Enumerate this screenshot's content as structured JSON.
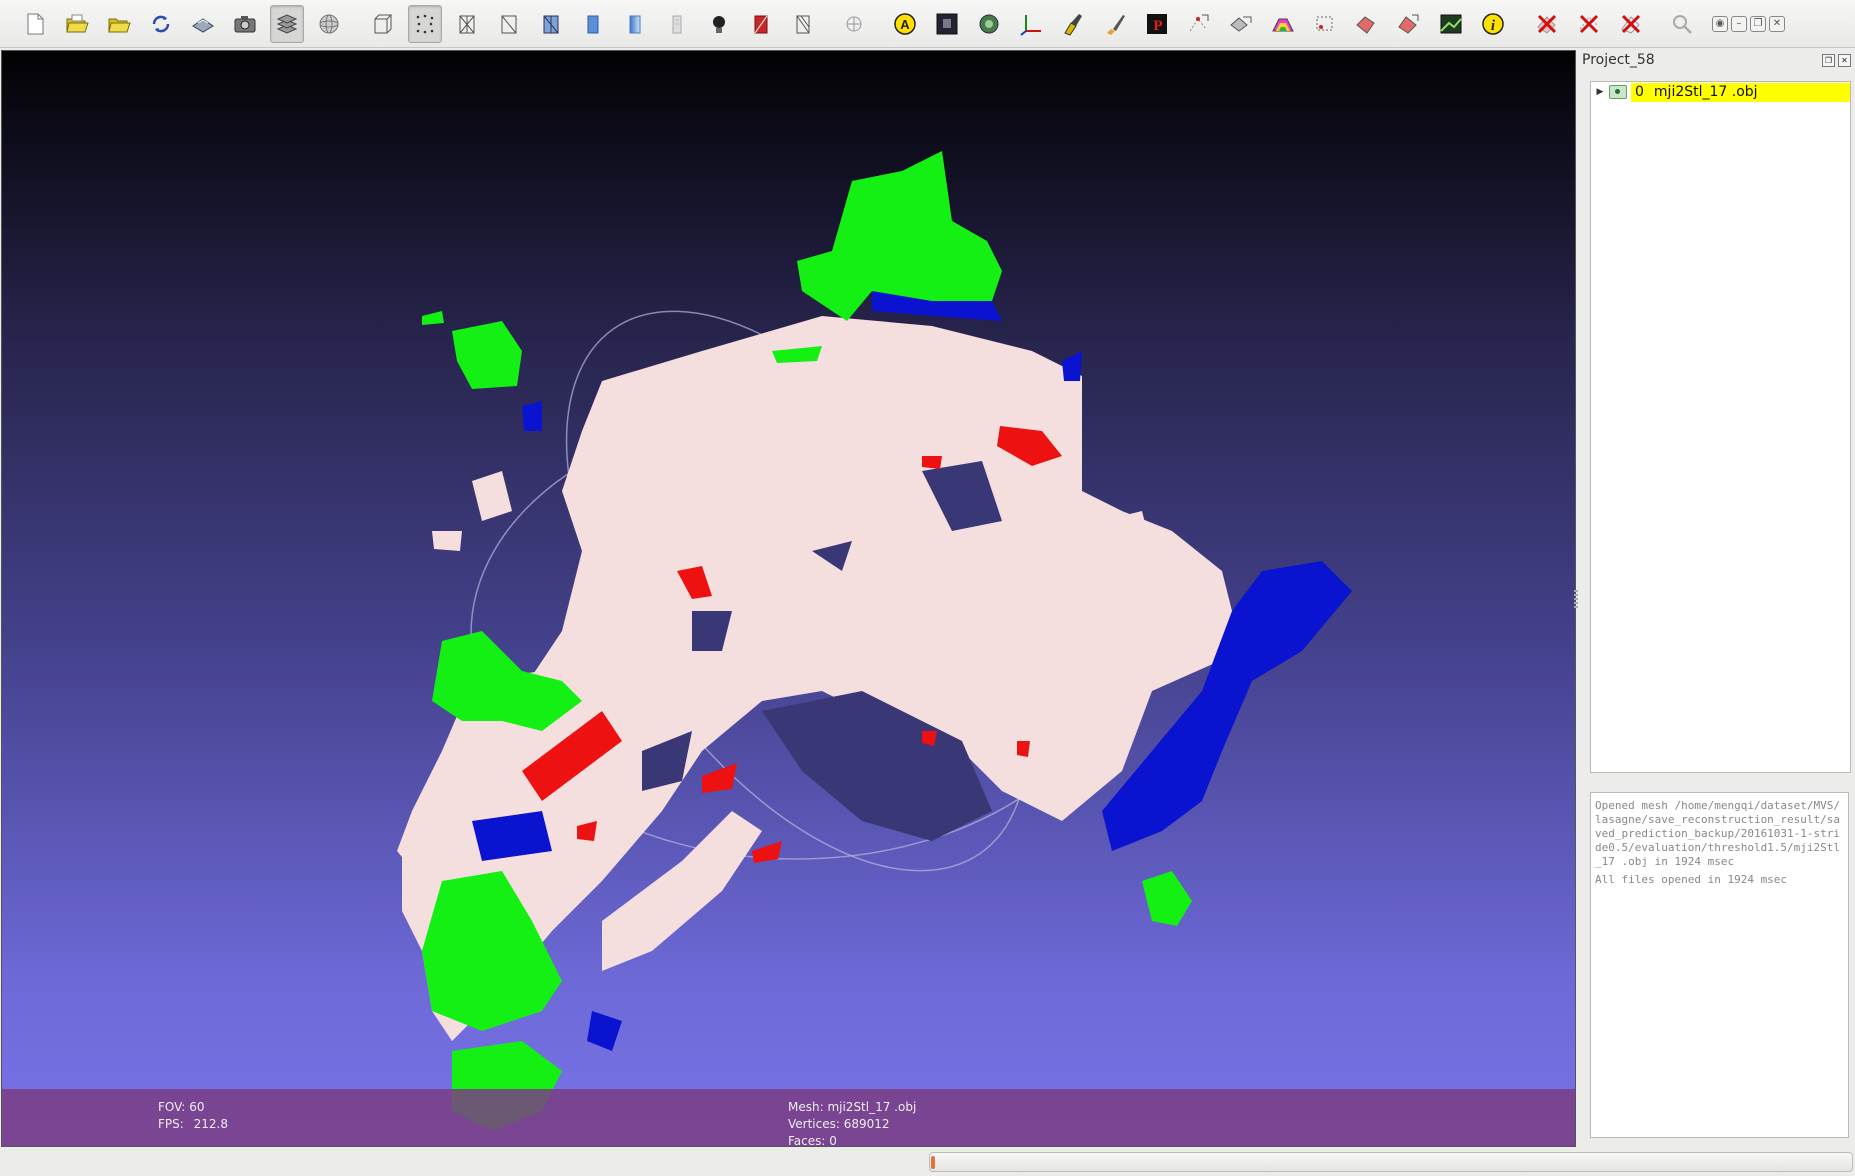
{
  "toolbar": {
    "buttons": [
      {
        "name": "new-project",
        "icon": "new-file-icon"
      },
      {
        "name": "open-project",
        "icon": "open-folder-icon"
      },
      {
        "name": "import-mesh",
        "icon": "folder-icon"
      },
      {
        "name": "reload",
        "icon": "reload-icon"
      },
      {
        "name": "export",
        "icon": "save-icon"
      },
      {
        "name": "snapshot",
        "icon": "camera-icon"
      },
      {
        "name": "layers",
        "icon": "layers-icon",
        "pressed": true
      },
      {
        "name": "trackball",
        "icon": "trackball-icon"
      },
      {
        "name": "bbox",
        "icon": "bbox-icon"
      },
      {
        "name": "points",
        "icon": "points-icon",
        "pressed": true
      },
      {
        "name": "wireframe",
        "icon": "wireframe-icon"
      },
      {
        "name": "hidden-lines",
        "icon": "hidden-lines-icon"
      },
      {
        "name": "flat-lines",
        "icon": "flat-lines-icon"
      },
      {
        "name": "flat",
        "icon": "flat-icon"
      },
      {
        "name": "smooth",
        "icon": "smooth-icon"
      },
      {
        "name": "texture",
        "icon": "texture-icon"
      },
      {
        "name": "light",
        "icon": "light-bulb-icon"
      },
      {
        "name": "backface",
        "icon": "backface-icon"
      },
      {
        "name": "double-side",
        "icon": "double-side-icon"
      },
      {
        "name": "globe",
        "icon": "globe-icon"
      },
      {
        "name": "annotation",
        "icon": "annotation-icon"
      },
      {
        "name": "raster",
        "icon": "raster-icon"
      },
      {
        "name": "select-region",
        "icon": "select-region-icon"
      },
      {
        "name": "axis",
        "icon": "axis-icon"
      },
      {
        "name": "paint",
        "icon": "paint-icon"
      },
      {
        "name": "brush",
        "icon": "brush-icon"
      },
      {
        "name": "measure",
        "icon": "measure-icon"
      },
      {
        "name": "select-vertices",
        "icon": "select-vertices-icon"
      },
      {
        "name": "select-faces",
        "icon": "select-faces-icon"
      },
      {
        "name": "color-faces",
        "icon": "color-faces-icon"
      },
      {
        "name": "select-connected",
        "icon": "select-connected-icon"
      },
      {
        "name": "delete-region",
        "icon": "delete-region-icon"
      },
      {
        "name": "delete-vertices",
        "icon": "delete-vertices-icon"
      },
      {
        "name": "image-align",
        "icon": "image-align-icon"
      },
      {
        "name": "info",
        "icon": "info-icon"
      },
      {
        "name": "delete-selected-faces",
        "icon": "delete-faces-icon"
      },
      {
        "name": "delete-selected-vertices",
        "icon": "delete-vertices-x-icon"
      },
      {
        "name": "delete-selected-all",
        "icon": "delete-all-icon"
      },
      {
        "name": "search",
        "icon": "search-icon"
      }
    ]
  },
  "viewport": {
    "fov_label": "FOV: 60",
    "fps_label": "FPS:",
    "fps_value": "212.8",
    "mesh_label": "Mesh: mji2Stl_17 .obj",
    "vertices_label": "Vertices: 689012",
    "faces_label": "Faces: 0"
  },
  "panel": {
    "title": "Project_58",
    "layers": [
      {
        "id": "0",
        "name": "mji2Stl_17 .obj",
        "selected": true
      }
    ],
    "log": [
      "Opened mesh /home/mengqi/dataset/MVS/lasagne/save_reconstruction_result/saved_prediction_backup/20161031-1-stride0.5/evaluation/threshold1.5/mji2Stl_17 .obj in 1924 msec",
      "All files opened in 1924 msec"
    ]
  },
  "status": {
    "progress_fraction": 0.004
  },
  "colors": {
    "accent_selected": "#ffff00",
    "point_green": "#14f014",
    "point_blue": "#0a14d0",
    "point_red": "#ee1111",
    "point_white": "#f6dede"
  }
}
